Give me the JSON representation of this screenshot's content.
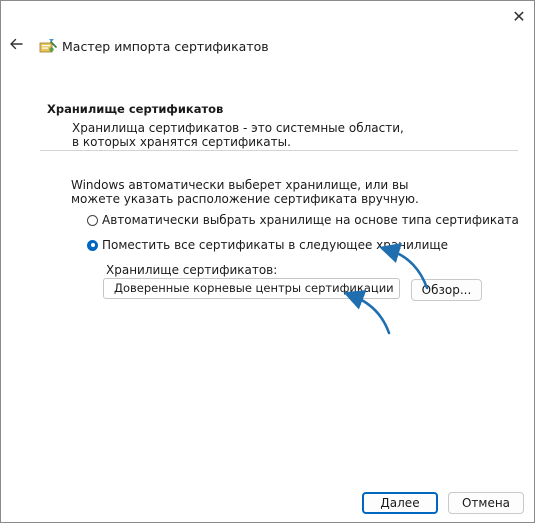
{
  "window": {
    "title": "Мастер импорта сертификатов",
    "close_label": "✕"
  },
  "header": {
    "title": "Хранилище сертификатов",
    "description": "Хранилища сертификатов - это системные области, в которых хранятся сертификаты."
  },
  "main": {
    "intro": "Windows автоматически выберет хранилище, или вы можете указать расположение сертификата вручную.",
    "options": [
      {
        "label": "Автоматически выбрать хранилище на основе типа сертификата",
        "checked": false
      },
      {
        "label": "Поместить все сертификаты в следующее хранилище",
        "checked": true
      }
    ],
    "store_label": "Хранилище сертификатов:",
    "store_value": "Доверенные корневые центры сертификации",
    "browse_label": "Обзор..."
  },
  "footer": {
    "next_label": "Далее",
    "cancel_label": "Отмена"
  },
  "colors": {
    "accent": "#0067c0",
    "annotation_arrow": "#1f6fb0"
  },
  "icons": {
    "close": "close-icon",
    "back": "back-arrow-icon",
    "wizard": "certificate-wizard-icon"
  }
}
